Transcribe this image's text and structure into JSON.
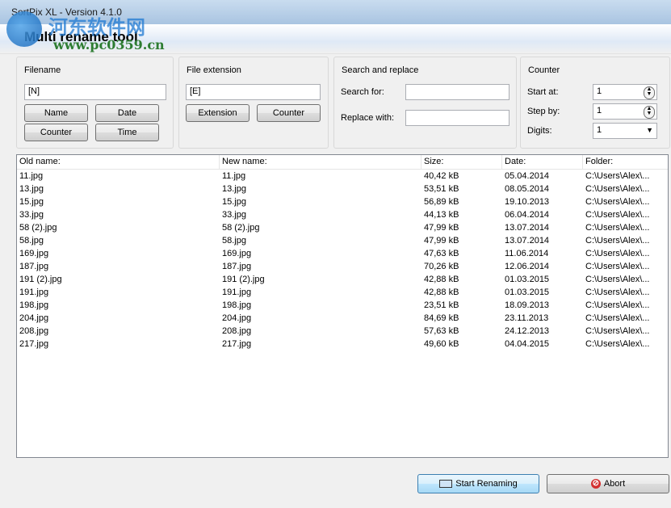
{
  "app": {
    "window_title": "SortPix XL - Version 4.1.0",
    "tool_title": "Multi rename tool",
    "watermark_cn": "河东软件网",
    "watermark_url": "www.pc0359.cn"
  },
  "filename": {
    "title": "Filename",
    "value": "[N]",
    "buttons": {
      "name": "Name",
      "date": "Date",
      "counter": "Counter",
      "time": "Time"
    }
  },
  "extension": {
    "title": "File extension",
    "value": "[E]",
    "buttons": {
      "extension": "Extension",
      "counter": "Counter"
    }
  },
  "search": {
    "title": "Search and replace",
    "search_for_label": "Search for:",
    "search_for_value": "",
    "replace_with_label": "Replace with:",
    "replace_with_value": ""
  },
  "counter": {
    "title": "Counter",
    "start_label": "Start at:",
    "start_value": "1",
    "step_label": "Step by:",
    "step_value": "1",
    "digits_label": "Digits:",
    "digits_value": "1"
  },
  "list": {
    "columns": [
      "Old name:",
      "New name:",
      "Size:",
      "Date:",
      "Folder:"
    ],
    "rows": [
      [
        "11.jpg",
        "11.jpg",
        "40,42 kB",
        "05.04.2014",
        "C:\\Users\\Alex\\..."
      ],
      [
        "13.jpg",
        "13.jpg",
        "53,51 kB",
        "08.05.2014",
        "C:\\Users\\Alex\\..."
      ],
      [
        "15.jpg",
        "15.jpg",
        "56,89 kB",
        "19.10.2013",
        "C:\\Users\\Alex\\..."
      ],
      [
        "33.jpg",
        "33.jpg",
        "44,13 kB",
        "06.04.2014",
        "C:\\Users\\Alex\\..."
      ],
      [
        "58 (2).jpg",
        "58 (2).jpg",
        "47,99 kB",
        "13.07.2014",
        "C:\\Users\\Alex\\..."
      ],
      [
        "58.jpg",
        "58.jpg",
        "47,99 kB",
        "13.07.2014",
        "C:\\Users\\Alex\\..."
      ],
      [
        "169.jpg",
        "169.jpg",
        "47,63 kB",
        "11.06.2014",
        "C:\\Users\\Alex\\..."
      ],
      [
        "187.jpg",
        "187.jpg",
        "70,26 kB",
        "12.06.2014",
        "C:\\Users\\Alex\\..."
      ],
      [
        "191 (2).jpg",
        "191 (2).jpg",
        "42,88 kB",
        "01.03.2015",
        "C:\\Users\\Alex\\..."
      ],
      [
        "191.jpg",
        "191.jpg",
        "42,88 kB",
        "01.03.2015",
        "C:\\Users\\Alex\\..."
      ],
      [
        "198.jpg",
        "198.jpg",
        "23,51 kB",
        "18.09.2013",
        "C:\\Users\\Alex\\..."
      ],
      [
        "204.jpg",
        "204.jpg",
        "84,69 kB",
        "23.11.2013",
        "C:\\Users\\Alex\\..."
      ],
      [
        "208.jpg",
        "208.jpg",
        "57,63 kB",
        "24.12.2013",
        "C:\\Users\\Alex\\..."
      ],
      [
        "217.jpg",
        "217.jpg",
        "49,60 kB",
        "04.04.2015",
        "C:\\Users\\Alex\\..."
      ]
    ]
  },
  "actions": {
    "start_label": "Start Renaming",
    "abort_label": "Abort"
  },
  "colors": {
    "title_bar": "#a9c4e1",
    "focus_border": "#3c7fb1",
    "abort_icon": "#d32f2f"
  }
}
